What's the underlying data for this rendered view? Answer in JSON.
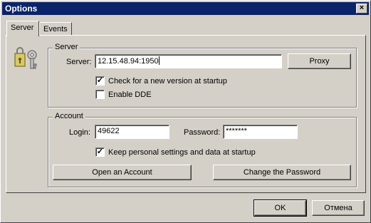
{
  "window": {
    "title": "Options",
    "close_glyph": "×"
  },
  "tabs": [
    {
      "label": "Server",
      "active": true
    },
    {
      "label": "Events",
      "active": false
    }
  ],
  "server_group": {
    "label": "Server",
    "server_label": "Server:",
    "server_value": "12.15.48.94:1950",
    "proxy_button": "Proxy",
    "check_version": {
      "label": "Check for a new version at startup",
      "checked": true
    },
    "enable_dde": {
      "label": "Enable DDE",
      "checked": false
    }
  },
  "account_group": {
    "label": "Account",
    "login_label": "Login:",
    "login_value": "49622",
    "password_label": "Password:",
    "password_value": "*******",
    "keep_settings": {
      "label": "Keep personal settings and data at startup",
      "checked": true
    },
    "open_account_button": "Open an Account",
    "change_password_button": "Change the Password"
  },
  "footer": {
    "ok_button": "OK",
    "cancel_button": "Отмена"
  },
  "icons": {
    "lock": "lock-key-icon"
  }
}
